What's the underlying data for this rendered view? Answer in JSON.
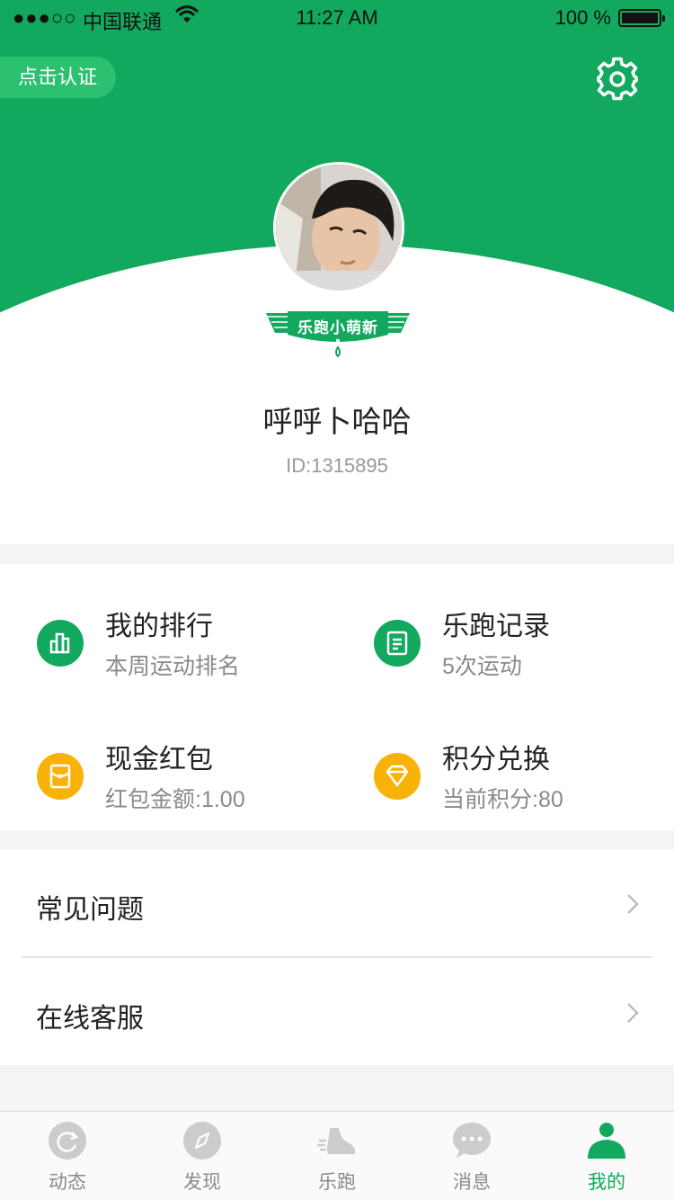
{
  "status_bar": {
    "signal": "●●●○○",
    "carrier": "中国联通",
    "time": "11:27 AM",
    "battery": "100 %"
  },
  "header": {
    "verify_label": "点击认证",
    "rank_badge": "乐跑小萌新",
    "username": "呼呼卜哈哈",
    "user_id": "ID:1315895",
    "brand_color": "#12a95e"
  },
  "grid": [
    {
      "title": "我的排行",
      "subtitle": "本周运动排名",
      "icon": "bar-chart-icon",
      "color": "#12a95e"
    },
    {
      "title": "乐跑记录",
      "subtitle": "5次运动",
      "icon": "document-icon",
      "color": "#12a95e"
    },
    {
      "title": "现金红包",
      "subtitle": "红包金额:1.00",
      "icon": "red-envelope-icon",
      "color": "#f9b208"
    },
    {
      "title": "积分兑换",
      "subtitle": "当前积分:80",
      "icon": "diamond-icon",
      "color": "#f9b208"
    }
  ],
  "list": [
    {
      "label": "常见问题"
    },
    {
      "label": "在线客服"
    }
  ],
  "tabs": [
    {
      "label": "动态",
      "icon": "refresh-icon"
    },
    {
      "label": "发现",
      "icon": "compass-icon"
    },
    {
      "label": "乐跑",
      "icon": "running-shoe-icon"
    },
    {
      "label": "消息",
      "icon": "chat-bubble-icon"
    },
    {
      "label": "我的",
      "icon": "person-icon",
      "active": true
    }
  ]
}
